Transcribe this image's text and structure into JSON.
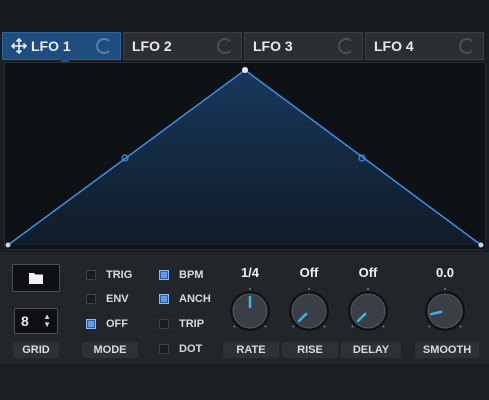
{
  "tabs": [
    {
      "label": "LFO 1",
      "active": true
    },
    {
      "label": "LFO 2",
      "active": false
    },
    {
      "label": "LFO 3",
      "active": false
    },
    {
      "label": "LFO 4",
      "active": false
    }
  ],
  "colors": {
    "accent": "#2f80d8",
    "active_tab": "#1e4e80",
    "checkbox_on": "#5b9bf0",
    "knob_indicator": "#37b7e8"
  },
  "grid": {
    "value": "8",
    "label": "GRID"
  },
  "mode": {
    "label": "MODE",
    "options": [
      {
        "label": "TRIG",
        "checked": false
      },
      {
        "label": "ENV",
        "checked": false
      },
      {
        "label": "OFF",
        "checked": true
      }
    ]
  },
  "options2": [
    {
      "label": "BPM",
      "checked": true
    },
    {
      "label": "ANCH",
      "checked": true
    },
    {
      "label": "TRIP",
      "checked": false
    },
    {
      "label": "DOT",
      "checked": false
    }
  ],
  "knobs": [
    {
      "name": "rate",
      "label": "RATE",
      "value": "1/4",
      "level": 0.5
    },
    {
      "name": "rise",
      "label": "RISE",
      "value": "Off",
      "level": 0.0
    },
    {
      "name": "delay",
      "label": "DELAY",
      "value": "Off",
      "level": 0.0
    },
    {
      "name": "smooth",
      "label": "SMOOTH",
      "value": "0.0",
      "level": 0.12
    }
  ],
  "icons": {
    "move": "move-icon",
    "folder": "folder-icon",
    "stepper": "up-down-arrows-icon",
    "tab_knob": "mini-knob-icon"
  }
}
